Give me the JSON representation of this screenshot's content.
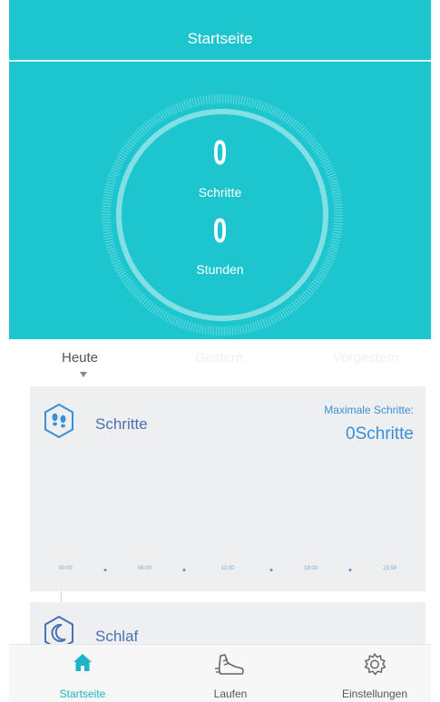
{
  "header": {
    "title": "Startseite"
  },
  "summary": {
    "steps_value": "0",
    "steps_label": "Schritte",
    "hours_value": "0",
    "hours_label": "Stunden"
  },
  "day_tabs": [
    {
      "label": "Heute",
      "active": true
    },
    {
      "label": "Gestern",
      "active": false
    },
    {
      "label": "Vorgestern",
      "active": false
    }
  ],
  "steps_card": {
    "title": "Schritte",
    "max_label": "Maximale Schritte:",
    "max_value": "0Schritte",
    "axis_ticks": [
      "00:00",
      "06:00",
      "12:00",
      "18:00",
      "23:59"
    ]
  },
  "sleep_card": {
    "title": "Schlaf"
  },
  "bottom_nav": [
    {
      "label": "Startseite",
      "icon": "home-icon",
      "active": true
    },
    {
      "label": "Laufen",
      "icon": "shoe-icon",
      "active": false
    },
    {
      "label": "Einstellungen",
      "icon": "gear-icon",
      "active": false
    }
  ],
  "colors": {
    "primary": "#1dc6cf",
    "accent_blue": "#3a8fd8",
    "card_bg": "#eeeff1",
    "nav_active": "#1eb4c6"
  }
}
